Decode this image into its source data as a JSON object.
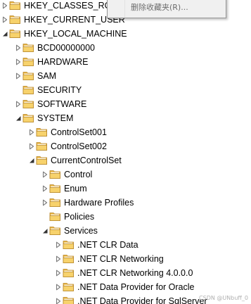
{
  "registry_tree": {
    "nodes": [
      {
        "label": "HKEY_CLASSES_ROOT",
        "depth": 0,
        "expander": "collapsed"
      },
      {
        "label": "HKEY_CURRENT_USER",
        "depth": 0,
        "expander": "collapsed"
      },
      {
        "label": "HKEY_LOCAL_MACHINE",
        "depth": 0,
        "expander": "expanded"
      },
      {
        "label": "BCD00000000",
        "depth": 1,
        "expander": "collapsed"
      },
      {
        "label": "HARDWARE",
        "depth": 1,
        "expander": "collapsed"
      },
      {
        "label": "SAM",
        "depth": 1,
        "expander": "collapsed"
      },
      {
        "label": "SECURITY",
        "depth": 1,
        "expander": "none"
      },
      {
        "label": "SOFTWARE",
        "depth": 1,
        "expander": "collapsed"
      },
      {
        "label": "SYSTEM",
        "depth": 1,
        "expander": "expanded"
      },
      {
        "label": "ControlSet001",
        "depth": 2,
        "expander": "collapsed"
      },
      {
        "label": "ControlSet002",
        "depth": 2,
        "expander": "collapsed"
      },
      {
        "label": "CurrentControlSet",
        "depth": 2,
        "expander": "expanded"
      },
      {
        "label": "Control",
        "depth": 3,
        "expander": "collapsed"
      },
      {
        "label": "Enum",
        "depth": 3,
        "expander": "collapsed"
      },
      {
        "label": "Hardware Profiles",
        "depth": 3,
        "expander": "collapsed"
      },
      {
        "label": "Policies",
        "depth": 3,
        "expander": "none"
      },
      {
        "label": "Services",
        "depth": 3,
        "expander": "expanded"
      },
      {
        "label": ".NET CLR Data",
        "depth": 4,
        "expander": "collapsed"
      },
      {
        "label": ".NET CLR Networking",
        "depth": 4,
        "expander": "collapsed"
      },
      {
        "label": ".NET CLR Networking 4.0.0.0",
        "depth": 4,
        "expander": "collapsed"
      },
      {
        "label": ".NET Data Provider for Oracle",
        "depth": 4,
        "expander": "collapsed"
      },
      {
        "label": ".NET Data Provider for SqlServer",
        "depth": 4,
        "expander": "collapsed"
      }
    ]
  },
  "context_menu": {
    "items": [
      {
        "label": "删除收藏夹(R)...",
        "enabled": false
      }
    ]
  },
  "watermark": "CSDN @UNbuff_0",
  "colors": {
    "folder_body": "#e8b33f",
    "folder_front": "#f7d26c",
    "folder_edge": "#b7862a",
    "expander_outline": "#7a7a7a",
    "expander_fill": "#333333",
    "disabled_text": "#6d6d6d"
  },
  "icons": {
    "collapsed_expander": "triangle-right-outline",
    "expanded_expander": "triangle-down-right-filled",
    "node": "folder"
  }
}
